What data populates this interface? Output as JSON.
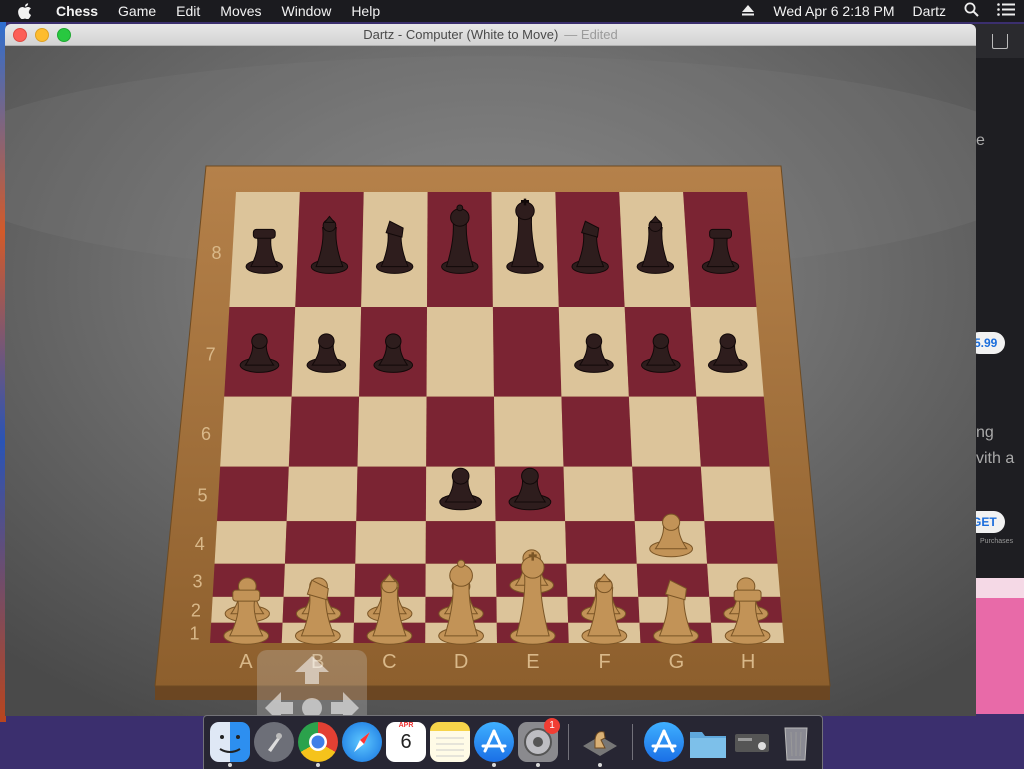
{
  "menubar": {
    "app_name": "Chess",
    "menus": [
      "Game",
      "Edit",
      "Moves",
      "Window",
      "Help"
    ],
    "clock": "Wed Apr 6  2:18 PM",
    "user": "Dartz"
  },
  "window": {
    "title": "Dartz - Computer   (White to Move)",
    "edited": "— Edited"
  },
  "board": {
    "files": [
      "A",
      "B",
      "C",
      "D",
      "E",
      "F",
      "G",
      "H"
    ],
    "ranks": [
      "1",
      "2",
      "3",
      "4",
      "5",
      "6",
      "7",
      "8"
    ],
    "colors": {
      "frame": "#a8753e",
      "light": "#dcc49a",
      "dark": "#7b2433",
      "white_piece": "#c29357",
      "black_piece": "#2e1d1d"
    },
    "pieces": [
      {
        "piece": "rook",
        "color": "white",
        "square": "a1"
      },
      {
        "piece": "knight",
        "color": "white",
        "square": "b1"
      },
      {
        "piece": "bishop",
        "color": "white",
        "square": "c1"
      },
      {
        "piece": "queen",
        "color": "white",
        "square": "d1"
      },
      {
        "piece": "king",
        "color": "white",
        "square": "e1"
      },
      {
        "piece": "bishop",
        "color": "white",
        "square": "f1"
      },
      {
        "piece": "knight",
        "color": "white",
        "square": "g1"
      },
      {
        "piece": "rook",
        "color": "white",
        "square": "h1"
      },
      {
        "piece": "pawn",
        "color": "white",
        "square": "a2"
      },
      {
        "piece": "pawn",
        "color": "white",
        "square": "b2"
      },
      {
        "piece": "pawn",
        "color": "white",
        "square": "c2"
      },
      {
        "piece": "pawn",
        "color": "white",
        "square": "d2"
      },
      {
        "piece": "pawn",
        "color": "white",
        "square": "f2"
      },
      {
        "piece": "pawn",
        "color": "white",
        "square": "h2"
      },
      {
        "piece": "pawn",
        "color": "white",
        "square": "e3"
      },
      {
        "piece": "pawn",
        "color": "white",
        "square": "g4"
      },
      {
        "piece": "pawn",
        "color": "black",
        "square": "d5"
      },
      {
        "piece": "pawn",
        "color": "black",
        "square": "e5"
      },
      {
        "piece": "pawn",
        "color": "black",
        "square": "a7"
      },
      {
        "piece": "pawn",
        "color": "black",
        "square": "b7"
      },
      {
        "piece": "pawn",
        "color": "black",
        "square": "c7"
      },
      {
        "piece": "pawn",
        "color": "black",
        "square": "f7"
      },
      {
        "piece": "pawn",
        "color": "black",
        "square": "g7"
      },
      {
        "piece": "pawn",
        "color": "black",
        "square": "h7"
      },
      {
        "piece": "rook",
        "color": "black",
        "square": "a8"
      },
      {
        "piece": "bishop",
        "color": "black",
        "square": "b8"
      },
      {
        "piece": "knight",
        "color": "black",
        "square": "c8"
      },
      {
        "piece": "queen",
        "color": "black",
        "square": "d8"
      },
      {
        "piece": "king",
        "color": "black",
        "square": "e8"
      },
      {
        "piece": "knight",
        "color": "black",
        "square": "f8"
      },
      {
        "piece": "bishop",
        "color": "black",
        "square": "g8"
      },
      {
        "piece": "rook",
        "color": "black",
        "square": "h8"
      }
    ]
  },
  "background_window": {
    "price": "5.99",
    "get_button": "GET",
    "purchases_fragment": "Purchases",
    "text_fragments": [
      "e",
      "ng",
      "vith a"
    ]
  },
  "dock": {
    "calendar_month": "APR",
    "calendar_day": "6",
    "badge_count": "1",
    "apps": [
      "finder-icon",
      "launchpad-icon",
      "chrome-icon",
      "safari-icon",
      "calendar-icon",
      "notes-icon",
      "app-store-icon",
      "system-preferences-icon",
      "chess-icon",
      "app-store-folder-icon",
      "folder-icon",
      "disk-utility-icon",
      "trash-icon"
    ]
  }
}
